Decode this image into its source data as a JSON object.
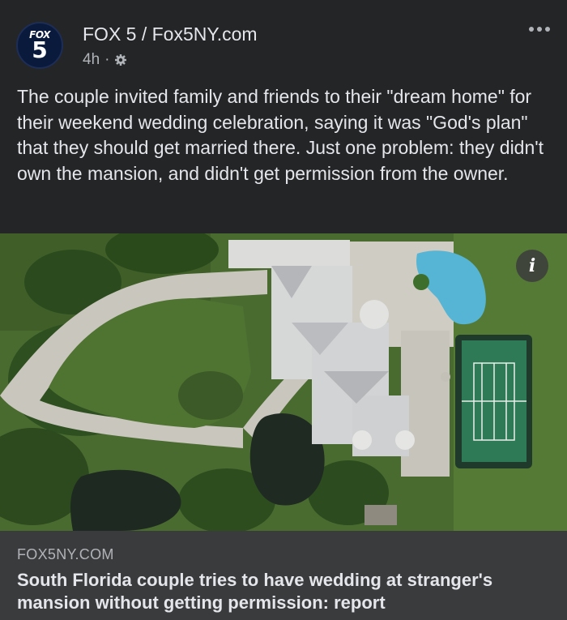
{
  "post": {
    "avatar": {
      "line1": "FOX",
      "line2": "5"
    },
    "page_name": "FOX 5 / Fox5NY.com",
    "time": "4h",
    "separator": "·",
    "audience_icon": "gear-icon",
    "more_icon": "more-options-icon",
    "text": "The couple invited family and friends to their \"dream home\" for their weekend wedding celebration, saying it was \"God's plan\" that they should get married there. Just one problem: they didn't own the mansion, and didn't get permission from the owner."
  },
  "image": {
    "info_label": "i",
    "description_icon": "info-icon"
  },
  "link": {
    "domain": "FOX5NY.COM",
    "title": "South Florida couple tries to have wedding at stranger's mansion without getting permission: report"
  },
  "colors": {
    "background": "#242526",
    "link_preview": "#3a3b3c",
    "primary_text": "#e4e6eb",
    "secondary_text": "#b0b3b8"
  }
}
